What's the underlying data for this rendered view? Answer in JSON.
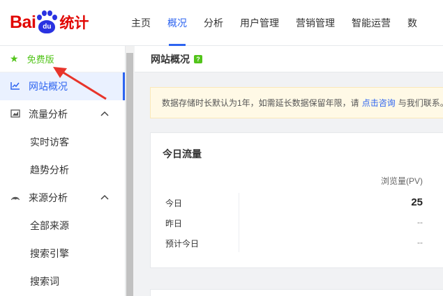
{
  "logo": {
    "bai": "Bai",
    "du": "du",
    "tongji": "统计"
  },
  "nav": {
    "items": [
      {
        "label": "主页"
      },
      {
        "label": "概况"
      },
      {
        "label": "分析"
      },
      {
        "label": "用户管理"
      },
      {
        "label": "营销管理"
      },
      {
        "label": "智能运营"
      },
      {
        "label": "数"
      }
    ],
    "active_index": 1
  },
  "sidebar": {
    "free_label": "免费版",
    "items": [
      {
        "label": "网站概况",
        "icon": "line-chart-icon",
        "active": true
      },
      {
        "label": "流量分析",
        "icon": "area-chart-icon",
        "expanded": true
      },
      {
        "label": "实时访客",
        "sub": true
      },
      {
        "label": "趋势分析",
        "sub": true
      },
      {
        "label": "来源分析",
        "icon": "signal-icon",
        "expanded": true
      },
      {
        "label": "全部来源",
        "sub": true
      },
      {
        "label": "搜索引擎",
        "sub": true
      },
      {
        "label": "搜索词",
        "sub": true
      }
    ]
  },
  "main": {
    "title": "网站概况",
    "help": "?",
    "notice": {
      "text_before": "数据存储时长默认为1年，如需延长数据保留年限，请",
      "link": "点击咨询",
      "text_after": "与我们联系。"
    },
    "traffic": {
      "title": "今日流量",
      "column": "浏览量(PV)",
      "rows": [
        {
          "label": "今日",
          "value": "25"
        },
        {
          "label": "昨日",
          "value": "--"
        },
        {
          "label": "预计今日",
          "value": "--"
        }
      ]
    }
  },
  "colors": {
    "accent": "#2d64f0",
    "free": "#52c41a",
    "logo_red": "#e10602",
    "logo_blue": "#2932e1",
    "annotation": "#e8342a"
  }
}
